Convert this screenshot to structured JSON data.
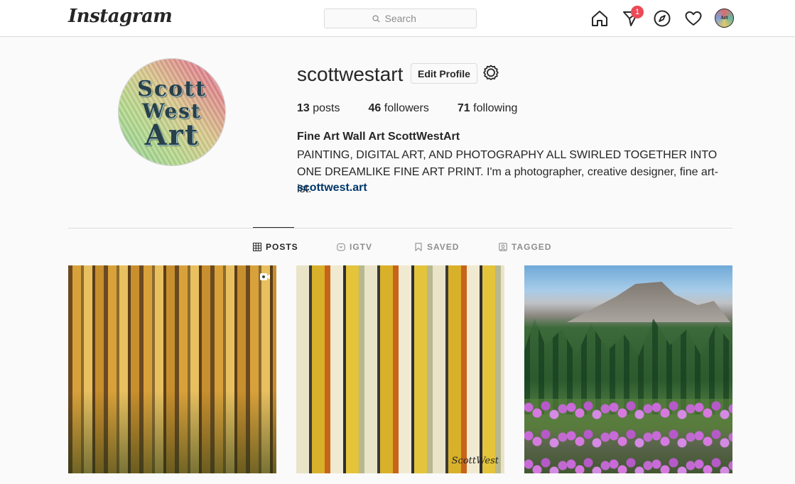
{
  "nav": {
    "logo": "Instagram",
    "search_placeholder": "Search",
    "icons": [
      "home-icon",
      "direct-messages-icon",
      "explore-icon",
      "activity-heart-icon"
    ],
    "dm_badge_count": "1"
  },
  "profile": {
    "avatar_lines": [
      "Scott",
      "West",
      "Art"
    ],
    "username": "scottwestart",
    "edit_label": "Edit Profile",
    "stats": {
      "posts_count": "13",
      "posts_label": "posts",
      "followers_count": "46",
      "followers_label": "followers",
      "following_count": "71",
      "following_label": "following"
    },
    "full_name": "Fine Art Wall Art ScottWestArt",
    "bio": "PAINTING, DIGITAL ART, AND PHOTOGRAPHY ALL SWIRLED TOGETHER INTO ONE DREAMLIKE FINE ART PRINT. I'm a photographer, creative designer, fine art-ist.",
    "website": "scottwest.art"
  },
  "tabs": [
    {
      "label": "POSTS",
      "active": true
    },
    {
      "label": "IGTV",
      "active": false
    },
    {
      "label": "SAVED",
      "active": false
    },
    {
      "label": "TAGGED",
      "active": false
    }
  ],
  "posts": {
    "p2_signature": "ScottWest"
  }
}
